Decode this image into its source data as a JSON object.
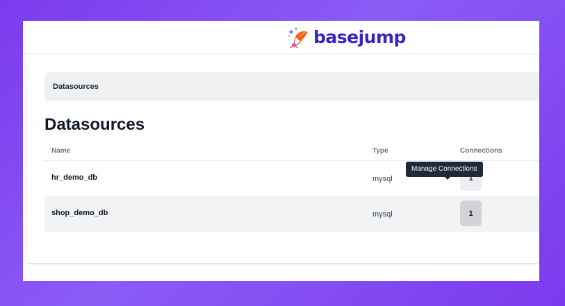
{
  "brand": {
    "name": "basejump",
    "logo_icon": "parachute-sparkle-icon",
    "color": "#3b22c6"
  },
  "breadcrumb": {
    "items": [
      "Datasources"
    ]
  },
  "page": {
    "title": "Datasources"
  },
  "table": {
    "columns": [
      "Name",
      "Type",
      "Connections"
    ],
    "rows": [
      {
        "name": "hr_demo_db",
        "type": "mysql",
        "connections": "1"
      },
      {
        "name": "shop_demo_db",
        "type": "mysql",
        "connections": "1"
      }
    ]
  },
  "tooltip": {
    "text": "Manage Connections"
  },
  "colors": {
    "background_gradient": [
      "#7c3aed",
      "#8b5cf6"
    ],
    "tooltip_bg": "#1f2937"
  }
}
